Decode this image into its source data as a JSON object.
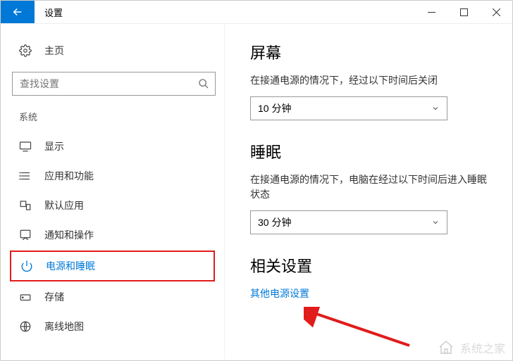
{
  "titlebar": {
    "title": "设置"
  },
  "sidebar": {
    "home_label": "主页",
    "search_placeholder": "查找设置",
    "group_label": "系统",
    "items": [
      {
        "label": "显示"
      },
      {
        "label": "应用和功能"
      },
      {
        "label": "默认应用"
      },
      {
        "label": "通知和操作"
      },
      {
        "label": "电源和睡眠"
      },
      {
        "label": "存储"
      },
      {
        "label": "离线地图"
      }
    ]
  },
  "main": {
    "screen": {
      "title": "屏幕",
      "desc": "在接通电源的情况下，经过以下时间后关闭",
      "value": "10 分钟"
    },
    "sleep": {
      "title": "睡眠",
      "desc": "在接通电源的情况下，电脑在经过以下时间后进入睡眠状态",
      "value": "30 分钟"
    },
    "related": {
      "title": "相关设置",
      "link": "其他电源设置"
    }
  },
  "watermark": {
    "text": "系统之家"
  }
}
